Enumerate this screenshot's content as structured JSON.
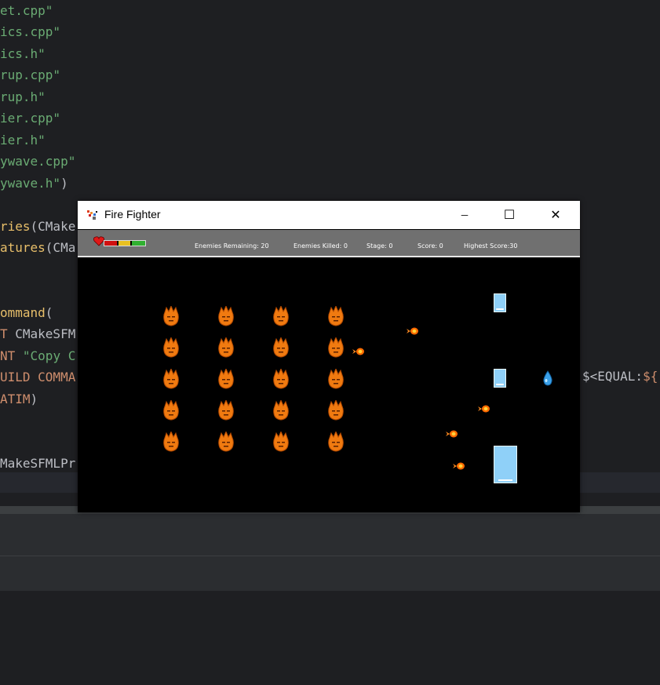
{
  "editor": {
    "lines": [
      {
        "parts": [
          {
            "t": "et.cpp\"",
            "c": "str"
          }
        ]
      },
      {
        "parts": [
          {
            "t": "ics.cpp\"",
            "c": "str"
          }
        ]
      },
      {
        "parts": [
          {
            "t": "ics.h\"",
            "c": "str"
          }
        ]
      },
      {
        "parts": [
          {
            "t": "rup.cpp\"",
            "c": "str"
          }
        ]
      },
      {
        "parts": [
          {
            "t": "rup.h\"",
            "c": "str"
          }
        ]
      },
      {
        "parts": [
          {
            "t": "ier.cpp\"",
            "c": "str"
          }
        ]
      },
      {
        "parts": [
          {
            "t": "ier.h\"",
            "c": "str"
          }
        ]
      },
      {
        "parts": [
          {
            "t": "ywave.cpp\"",
            "c": "str"
          }
        ]
      },
      {
        "parts": [
          {
            "t": "ywave.h\"",
            "c": "str"
          },
          {
            "t": ")",
            "c": "plain"
          }
        ]
      },
      {
        "parts": []
      },
      {
        "parts": [
          {
            "t": "ries",
            "c": "fn"
          },
          {
            "t": "(CMake",
            "c": "plain"
          }
        ]
      },
      {
        "parts": [
          {
            "t": "atures",
            "c": "fn"
          },
          {
            "t": "(CMa",
            "c": "plain"
          }
        ]
      },
      {
        "parts": []
      },
      {
        "parts": []
      },
      {
        "parts": [
          {
            "t": "ommand",
            "c": "fn"
          },
          {
            "t": "(",
            "c": "plain"
          }
        ]
      },
      {
        "parts": [
          {
            "t": "T ",
            "c": "kw"
          },
          {
            "t": "CMakeSFM",
            "c": "plain"
          }
        ]
      },
      {
        "parts": [
          {
            "t": "NT ",
            "c": "kw"
          },
          {
            "t": "\"Copy C",
            "c": "str"
          }
        ]
      },
      {
        "parts": [
          {
            "t": "UILD COMMA",
            "c": "kw"
          }
        ]
      },
      {
        "parts": [
          {
            "t": "ATIM",
            "c": "kw"
          },
          {
            "t": ")",
            "c": "plain"
          }
        ]
      },
      {
        "parts": []
      },
      {
        "parts": []
      },
      {
        "parts": [
          {
            "t": "MakeSFMLPr",
            "c": "plain"
          }
        ]
      }
    ],
    "right_fragment": [
      {
        "t": "$<EQUAL:",
        "c": "plain"
      },
      {
        "t": "${",
        "c": "kw"
      }
    ]
  },
  "window": {
    "title": "Fire Fighter",
    "app_icon": "fire-fighter-app-icon",
    "controls": {
      "minimize": "─",
      "maximize": "☐",
      "close": "✕"
    }
  },
  "hud": {
    "health_icon": "heart-icon",
    "health_level": 1.0,
    "enemies_remaining": "Enemies Remaining: 20",
    "enemies_killed": "Enemies Killed: 0",
    "stage": "Stage: 0",
    "score": "Score: 0",
    "highest_score": "Highest Score:30"
  },
  "game": {
    "enemy_grid": {
      "rows": 5,
      "cols": 4
    },
    "enemy_color": "#f07a10",
    "fireball_count": 5,
    "barrier_count": 3,
    "player_icon": "water-drop-icon",
    "barrier_color": "#8fd0f8"
  }
}
